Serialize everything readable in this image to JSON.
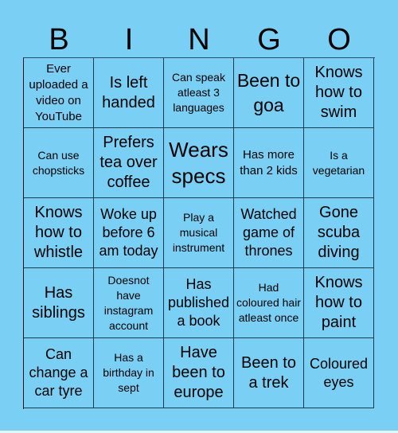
{
  "card": {
    "header_letters": [
      "B",
      "I",
      "N",
      "G",
      "O"
    ],
    "cells": [
      [
        "Ever uploaded a video on YouTube",
        "Is left handed",
        "Can speak atleast 3 languages",
        "Been to goa",
        "Knows how to swim"
      ],
      [
        "Can use chopsticks",
        "Prefers tea over coffee",
        "Wears specs",
        "Has more than 2 kids",
        "Is a vegetarian"
      ],
      [
        "Knows how to whistle",
        "Woke up before 6 am today",
        "Play a musical instrument",
        "Watched game of thrones",
        "Gone scuba diving"
      ],
      [
        "Has siblings",
        "Doesnot have instagram account",
        "Has published a book",
        "Had coloured hair atleast once",
        "Knows how to paint"
      ],
      [
        "Can change a car tyre",
        "Has a birthday in sept",
        "Have been to europe",
        "Been to a trek",
        "Coloured eyes"
      ]
    ]
  },
  "colors": {
    "background": "#7acff5",
    "grid_lines": "#1d3a4d",
    "text": "#000000"
  }
}
